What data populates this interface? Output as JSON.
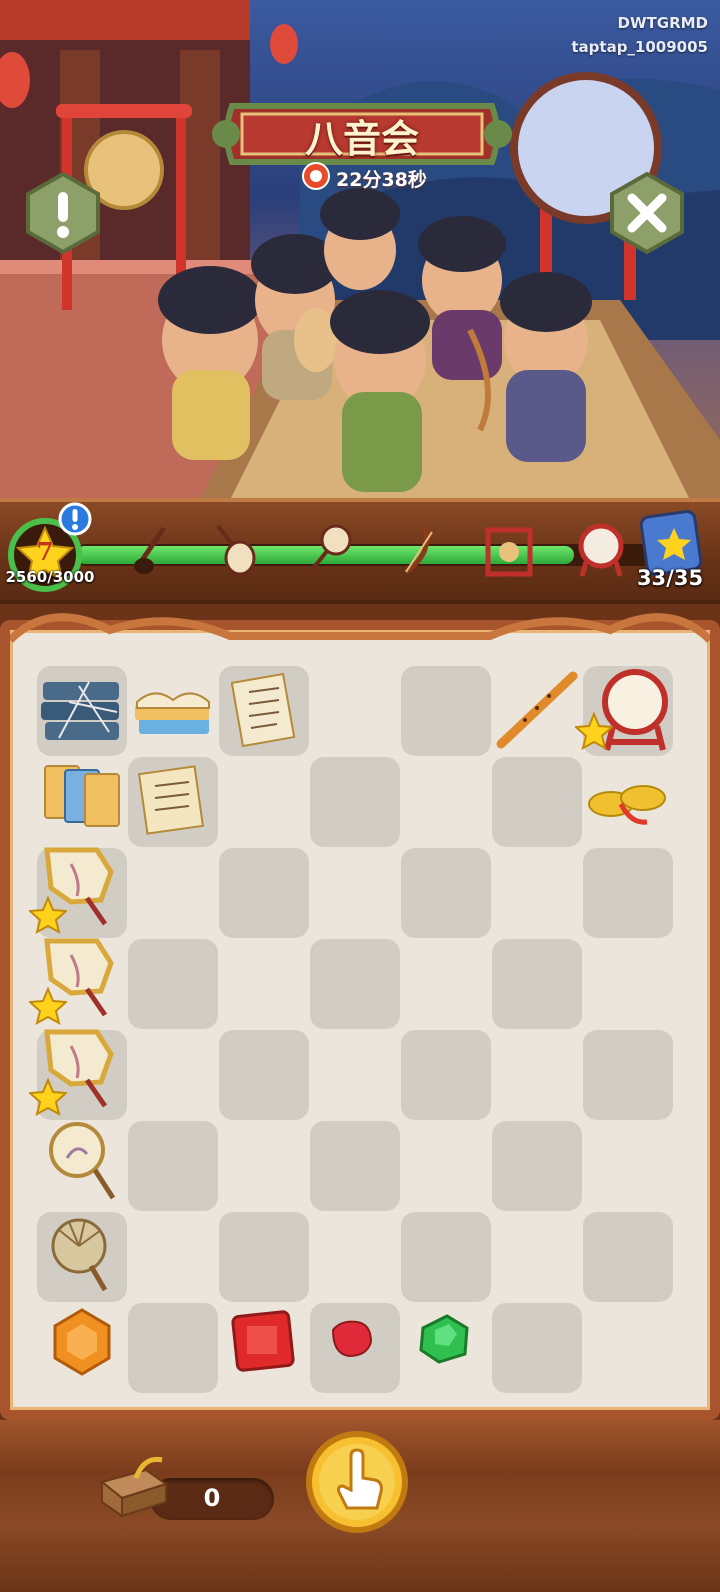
{
  "event": {
    "title": "八音会",
    "timer": "22分38秒"
  },
  "watermark": {
    "line1": "DWTGRMD",
    "line2": "taptap_1009005"
  },
  "buttons": {
    "info": "info-icon",
    "close": "close-icon",
    "tap": "hand-pointer-icon"
  },
  "progress": {
    "level": "7",
    "xp": "2560/3000",
    "fill_fraction": 0.85,
    "stages": [
      "erhu-icon",
      "pipa-icon",
      "ruan-icon",
      "harp-icon",
      "gong-icon",
      "drum-icon"
    ],
    "collection_count": "33/35"
  },
  "board": {
    "items": [
      {
        "name": "dusty-books-icon",
        "starred": false
      },
      {
        "name": "open-book-stack-icon",
        "starred": false
      },
      {
        "name": "sheet-music-icon",
        "starred": false
      },
      {
        "name": "flute-icon",
        "starred": false
      },
      {
        "name": "drum-icon",
        "starred": true
      },
      {
        "name": "scripture-books-icon",
        "starred": false
      },
      {
        "name": "scroll-icon",
        "starred": false
      },
      {
        "name": "cymbals-icon",
        "starred": false
      },
      {
        "name": "embroidered-fan-icon",
        "starred": true
      },
      {
        "name": "embroidered-fan-icon",
        "starred": true
      },
      {
        "name": "embroidered-fan-icon",
        "starred": true
      },
      {
        "name": "round-fan-icon",
        "starred": false
      },
      {
        "name": "palm-fan-icon",
        "starred": false
      },
      {
        "name": "amber-gem-icon",
        "starred": false
      },
      {
        "name": "ruby-gem-icon",
        "starred": false
      },
      {
        "name": "red-pebble-icon",
        "starred": false
      },
      {
        "name": "emerald-gem-icon",
        "starred": false
      }
    ]
  },
  "footer": {
    "count": "0"
  },
  "colors": {
    "frame": "#a8542c",
    "board": "#ebe5dc",
    "cell": "#d2cdc4",
    "bar_fill": "#3cc04a",
    "star": "#ffd21e"
  }
}
